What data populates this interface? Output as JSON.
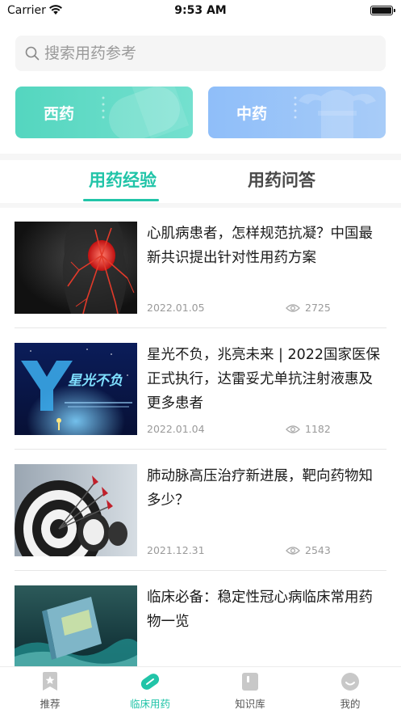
{
  "status_bar": {
    "carrier": "Carrier",
    "time": "9:53 AM"
  },
  "search": {
    "placeholder": "搜索用药参考"
  },
  "categories": [
    {
      "label": "西药",
      "color": "#54d6bf"
    },
    {
      "label": "中药",
      "color": "#8fbef9"
    }
  ],
  "tabs": [
    {
      "label": "用药经验",
      "active": true
    },
    {
      "label": "用药问答",
      "active": false
    }
  ],
  "articles": [
    {
      "title": "心肌病患者，怎样规范抗凝？中国最新共识提出针对性用药方案",
      "date": "2022.01.05",
      "views": "2725",
      "thumb": "heart-illustration"
    },
    {
      "title": "星光不负，兆亮未来 | 2022国家医保正式执行，达雷妥尤单抗注射液惠及更多患者",
      "date": "2022.01.04",
      "views": "1182",
      "thumb": "star-event-banner",
      "thumb_text": "星光不负"
    },
    {
      "title": "肺动脉高压治疗新进展，靶向药物知多少？",
      "date": "2021.12.31",
      "views": "2543",
      "thumb": "target-darts"
    },
    {
      "title": "临床必备：稳定性冠心病临床常用药物一览",
      "date": "",
      "views": "",
      "thumb": "book-wave"
    }
  ],
  "tabbar": [
    {
      "label": "推荐",
      "icon": "star-bookmark-icon",
      "active": false
    },
    {
      "label": "临床用药",
      "icon": "pill-icon",
      "active": true
    },
    {
      "label": "知识库",
      "icon": "book-icon",
      "active": false
    },
    {
      "label": "我的",
      "icon": "profile-icon",
      "active": false
    }
  ],
  "colors": {
    "accent": "#21c4a8",
    "inactive": "#c8c8c8"
  }
}
